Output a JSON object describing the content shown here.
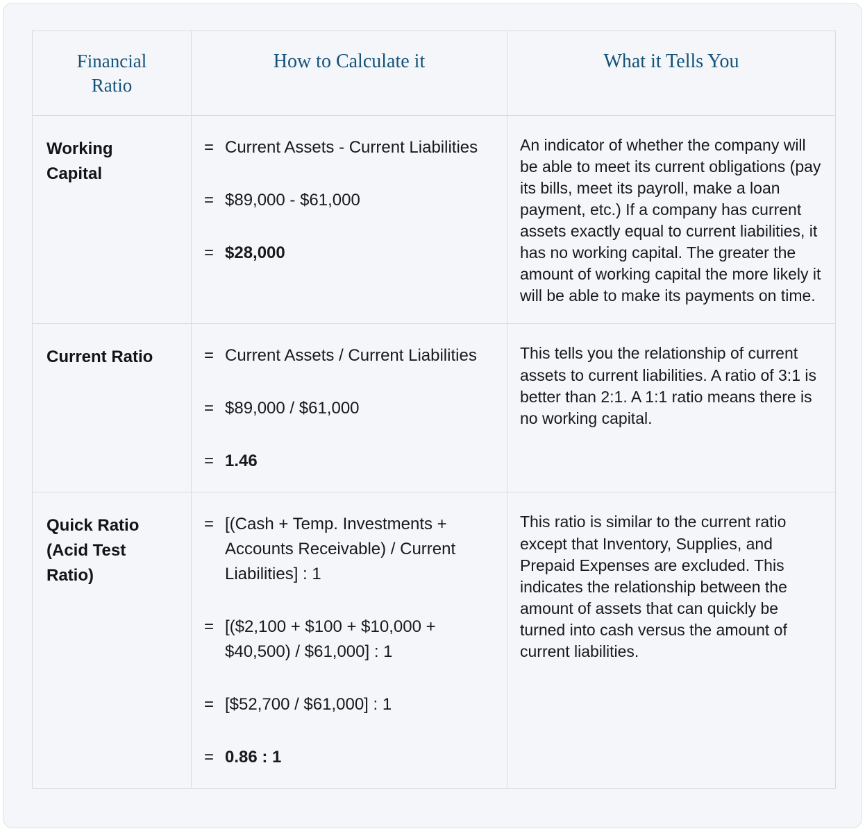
{
  "table": {
    "headers": [
      {
        "label": "Financial\nRatio",
        "line1": "Financial",
        "line2": "Ratio"
      },
      {
        "label": "How to Calculate it"
      },
      {
        "label": "What it Tells You"
      }
    ],
    "header_color": "#14527a",
    "rows": [
      {
        "name": "Working Capital",
        "name_line1": "Working",
        "name_line2": "Capital",
        "formulas": [
          {
            "eq": "=",
            "expr": "Current Assets - Current Liabilities",
            "bold": false
          },
          {
            "eq": "=",
            "expr": "$89,000 - $61,000",
            "bold": false
          },
          {
            "eq": "=",
            "expr": "$28,000",
            "bold": true
          }
        ],
        "tells": "An indicator of whether the company will be able to meet its current obligations (pay its bills, meet its payroll, make a loan payment, etc.) If a company has current assets exactly equal to current liabilities, it has no working capital. The greater the amount of working capital the more likely it will be able to make its payments on time."
      },
      {
        "name": "Current Ratio",
        "name_line1": "Current Ratio",
        "name_line2": "",
        "formulas": [
          {
            "eq": "=",
            "expr": "Current Assets / Current Liabilities",
            "bold": false
          },
          {
            "eq": "=",
            "expr": "$89,000 / $61,000",
            "bold": false
          },
          {
            "eq": "=",
            "expr": "1.46",
            "bold": true
          }
        ],
        "tells": "This tells you the relationship of current assets to current liabilities. A ratio of 3:1 is better than 2:1. A 1:1 ratio means there is no working capital."
      },
      {
        "name": "Quick Ratio (Acid Test Ratio)",
        "name_line1": "Quick Ratio",
        "name_line2": "(Acid Test",
        "name_line3": "Ratio)",
        "formulas": [
          {
            "eq": "=",
            "expr": "[(Cash + Temp. Investments + Accounts Receivable) / Current Liabilities] : 1",
            "bold": false
          },
          {
            "eq": "=",
            "expr": "[($2,100 + $100 + $10,000 + $40,500) / $61,000] : 1",
            "bold": false
          },
          {
            "eq": "=",
            "expr": "[$52,700 / $61,000] : 1",
            "bold": false
          },
          {
            "eq": "=",
            "expr": "0.86 : 1",
            "bold": true
          }
        ],
        "tells": "This ratio is similar to the current ratio except that Inventory, Supplies, and Prepaid Expenses are excluded. This indicates the relationship between the amount of assets that can quickly be turned into cash versus the amount of current liabilities."
      }
    ]
  }
}
